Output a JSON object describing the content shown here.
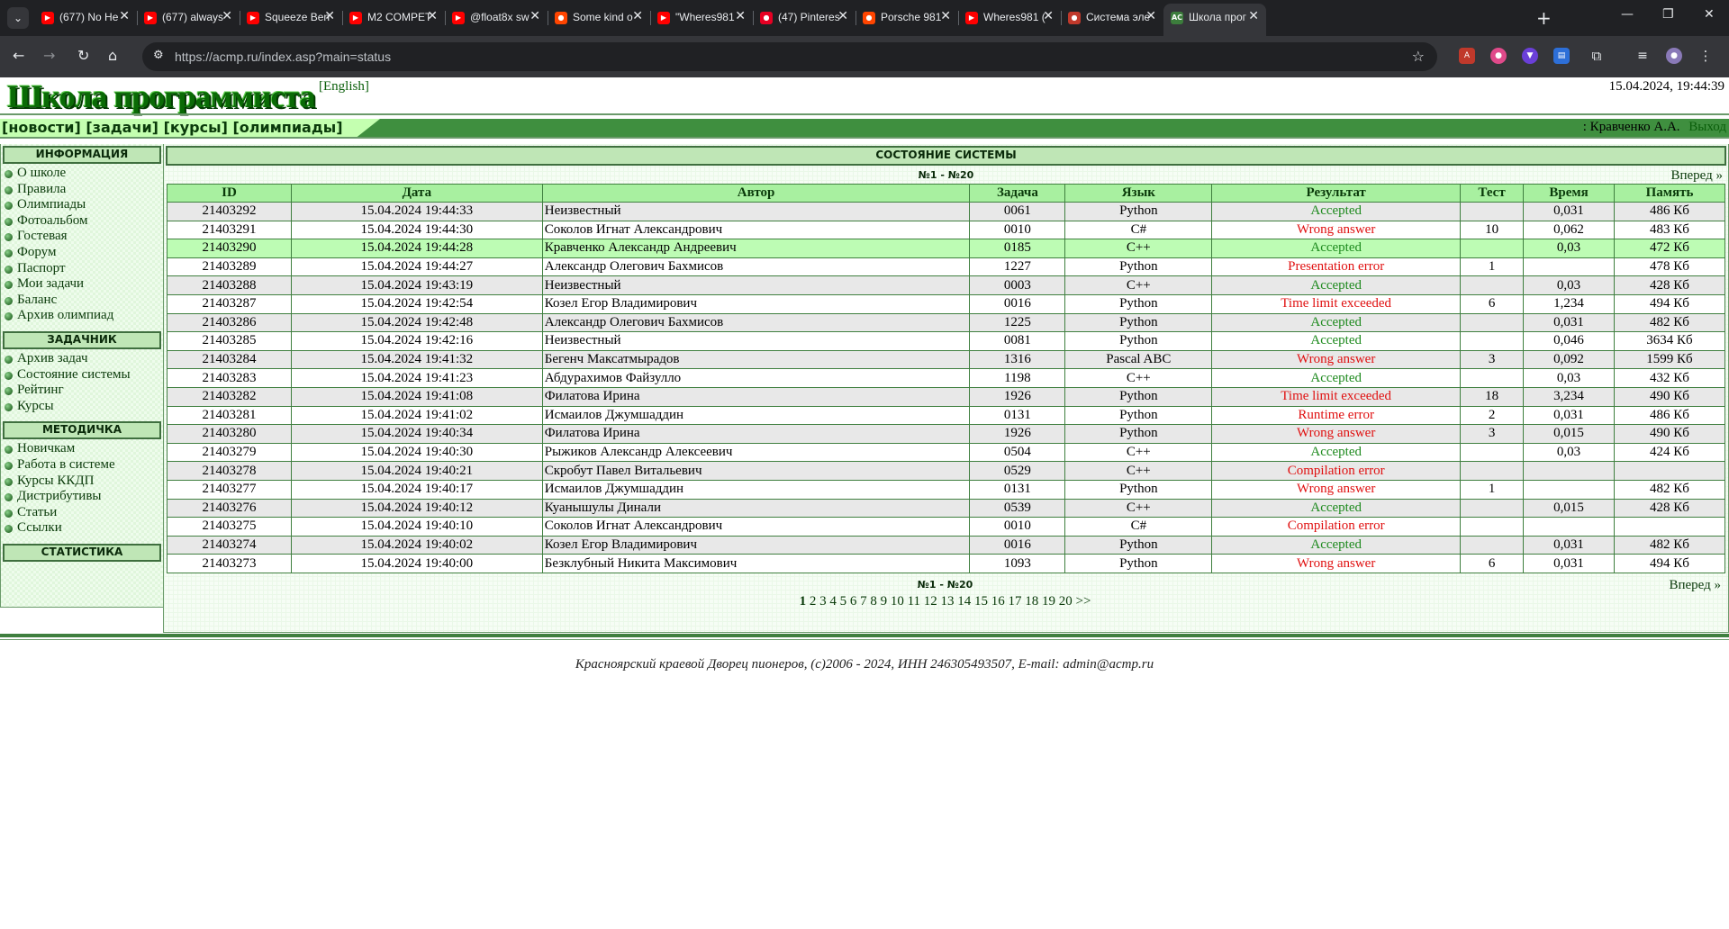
{
  "browser": {
    "tabs": [
      {
        "title": "(677) No He",
        "icon": "youtube-icon",
        "color": "#ff0000"
      },
      {
        "title": "(677) always",
        "icon": "youtube-icon",
        "color": "#ff0000"
      },
      {
        "title": "Squeeze Ben",
        "icon": "youtube-icon",
        "color": "#ff0000"
      },
      {
        "title": "M2 COMPETI",
        "icon": "youtube-icon",
        "color": "#ff0000"
      },
      {
        "title": "@float8x sw",
        "icon": "youtube-icon",
        "color": "#ff0000"
      },
      {
        "title": "Some kind o",
        "icon": "reddit-icon",
        "color": "#ff4500"
      },
      {
        "title": "\"Wheres981",
        "icon": "youtube-icon",
        "color": "#ff0000"
      },
      {
        "title": "(47) Pinteres",
        "icon": "pinterest-icon",
        "color": "#e60023"
      },
      {
        "title": "Porsche 981",
        "icon": "reddit-icon",
        "color": "#ff4500"
      },
      {
        "title": "Wheres981 (",
        "icon": "youtube-icon",
        "color": "#ff0000"
      },
      {
        "title": "Система эле",
        "icon": "im-icon",
        "color": "#c0392b"
      },
      {
        "title": "Школа прог",
        "icon": "acmp-icon",
        "color": "#3c7d3c",
        "active": true
      }
    ],
    "url": "https://acmp.ru/index.asp?main=status"
  },
  "site": {
    "logo": "Школа программиста",
    "lang_link": "[English]",
    "datetime": "15.04.2024, 19:44:39",
    "nav": [
      "[новости]",
      "[задачи]",
      "[курсы]",
      "[олимпиады]"
    ],
    "user": ": Кравченко А.А.",
    "logout": "Выход"
  },
  "sidebar": {
    "sections": [
      {
        "title": "ИНФОРМАЦИЯ",
        "items": [
          "О школе",
          "Правила",
          "Олимпиады",
          "Фотоальбом",
          "Гостевая",
          "Форум",
          "Паспорт",
          "Мои задачи",
          "Баланс",
          "Архив олимпиад"
        ]
      },
      {
        "title": "ЗАДАЧНИК",
        "items": [
          "Архив задач",
          "Состояние системы",
          "Рейтинг",
          "Курсы"
        ]
      },
      {
        "title": "МЕТОДИЧКА",
        "items": [
          "Новичкам",
          "Работа в системе",
          "Курсы ККДП",
          "Дистрибутивы",
          "Статьи",
          "Ссылки"
        ]
      },
      {
        "title": "СТАТИСТИКА",
        "items": []
      }
    ]
  },
  "main": {
    "title": "СОСТОЯНИЕ СИСТЕМЫ",
    "range": "№1 - №20",
    "next": "Вперед »",
    "columns": [
      "ID",
      "Дата",
      "Автор",
      "Задача",
      "Язык",
      "Результат",
      "Тест",
      "Время",
      "Память"
    ],
    "rows": [
      {
        "id": "21403292",
        "date": "15.04.2024 19:44:33",
        "author": "Неизвестный",
        "task": "0061",
        "lang": "Python",
        "result": "Accepted",
        "ok": true,
        "test": "",
        "time": "0,031",
        "mem": "486 Кб"
      },
      {
        "id": "21403291",
        "date": "15.04.2024 19:44:30",
        "author": "Соколов Игнат Александрович",
        "task": "0010",
        "lang": "C#",
        "result": "Wrong answer",
        "ok": false,
        "test": "10",
        "time": "0,062",
        "mem": "483 Кб"
      },
      {
        "id": "21403290",
        "date": "15.04.2024 19:44:28",
        "author": "Кравченко Александр Андреевич",
        "task": "0185",
        "lang": "C++",
        "result": "Accepted",
        "ok": true,
        "test": "",
        "time": "0,03",
        "mem": "472 Кб",
        "mine": true
      },
      {
        "id": "21403289",
        "date": "15.04.2024 19:44:27",
        "author": "Александр Олегович Бахмисов",
        "task": "1227",
        "lang": "Python",
        "result": "Presentation error",
        "ok": false,
        "test": "1",
        "time": "",
        "mem": "478 Кб"
      },
      {
        "id": "21403288",
        "date": "15.04.2024 19:43:19",
        "author": "Неизвестный",
        "task": "0003",
        "lang": "C++",
        "result": "Accepted",
        "ok": true,
        "test": "",
        "time": "0,03",
        "mem": "428 Кб"
      },
      {
        "id": "21403287",
        "date": "15.04.2024 19:42:54",
        "author": "Козел Егор Владимирович",
        "task": "0016",
        "lang": "Python",
        "result": "Time limit exceeded",
        "ok": false,
        "test": "6",
        "time": "1,234",
        "mem": "494 Кб"
      },
      {
        "id": "21403286",
        "date": "15.04.2024 19:42:48",
        "author": "Александр Олегович Бахмисов",
        "task": "1225",
        "lang": "Python",
        "result": "Accepted",
        "ok": true,
        "test": "",
        "time": "0,031",
        "mem": "482 Кб"
      },
      {
        "id": "21403285",
        "date": "15.04.2024 19:42:16",
        "author": "Неизвестный",
        "task": "0081",
        "lang": "Python",
        "result": "Accepted",
        "ok": true,
        "test": "",
        "time": "0,046",
        "mem": "3634 Кб"
      },
      {
        "id": "21403284",
        "date": "15.04.2024 19:41:32",
        "author": "Бегенч Максатмырадов",
        "task": "1316",
        "lang": "Pascal ABC",
        "result": "Wrong answer",
        "ok": false,
        "test": "3",
        "time": "0,092",
        "mem": "1599 Кб"
      },
      {
        "id": "21403283",
        "date": "15.04.2024 19:41:23",
        "author": "Абдурахимов Файзулло",
        "task": "1198",
        "lang": "C++",
        "result": "Accepted",
        "ok": true,
        "test": "",
        "time": "0,03",
        "mem": "432 Кб"
      },
      {
        "id": "21403282",
        "date": "15.04.2024 19:41:08",
        "author": "Филатова Ирина",
        "task": "1926",
        "lang": "Python",
        "result": "Time limit exceeded",
        "ok": false,
        "test": "18",
        "time": "3,234",
        "mem": "490 Кб"
      },
      {
        "id": "21403281",
        "date": "15.04.2024 19:41:02",
        "author": "Исмаилов Джумшаддин",
        "task": "0131",
        "lang": "Python",
        "result": "Runtime error",
        "ok": false,
        "test": "2",
        "time": "0,031",
        "mem": "486 Кб"
      },
      {
        "id": "21403280",
        "date": "15.04.2024 19:40:34",
        "author": "Филатова Ирина",
        "task": "1926",
        "lang": "Python",
        "result": "Wrong answer",
        "ok": false,
        "test": "3",
        "time": "0,015",
        "mem": "490 Кб"
      },
      {
        "id": "21403279",
        "date": "15.04.2024 19:40:30",
        "author": "Рыжиков Александр Алексеевич",
        "task": "0504",
        "lang": "C++",
        "result": "Accepted",
        "ok": true,
        "test": "",
        "time": "0,03",
        "mem": "424 Кб"
      },
      {
        "id": "21403278",
        "date": "15.04.2024 19:40:21",
        "author": "Скробут Павел Витальевич",
        "task": "0529",
        "lang": "C++",
        "result": "Compilation error",
        "ok": false,
        "test": "",
        "time": "",
        "mem": ""
      },
      {
        "id": "21403277",
        "date": "15.04.2024 19:40:17",
        "author": "Исмаилов Джумшаддин",
        "task": "0131",
        "lang": "Python",
        "result": "Wrong answer",
        "ok": false,
        "test": "1",
        "time": "",
        "mem": "482 Кб"
      },
      {
        "id": "21403276",
        "date": "15.04.2024 19:40:12",
        "author": "Куанышулы Динали",
        "task": "0539",
        "lang": "C++",
        "result": "Accepted",
        "ok": true,
        "test": "",
        "time": "0,015",
        "mem": "428 Кб"
      },
      {
        "id": "21403275",
        "date": "15.04.2024 19:40:10",
        "author": "Соколов Игнат Александрович",
        "task": "0010",
        "lang": "C#",
        "result": "Compilation error",
        "ok": false,
        "test": "",
        "time": "",
        "mem": ""
      },
      {
        "id": "21403274",
        "date": "15.04.2024 19:40:02",
        "author": "Козел Егор Владимирович",
        "task": "0016",
        "lang": "Python",
        "result": "Accepted",
        "ok": true,
        "test": "",
        "time": "0,031",
        "mem": "482 Кб"
      },
      {
        "id": "21403273",
        "date": "15.04.2024 19:40:00",
        "author": "Безклубный Никита Максимович",
        "task": "1093",
        "lang": "Python",
        "result": "Wrong answer",
        "ok": false,
        "test": "6",
        "time": "0,031",
        "mem": "494 Кб"
      }
    ],
    "pages": [
      "1",
      "2",
      "3",
      "4",
      "5",
      "6",
      "7",
      "8",
      "9",
      "10",
      "11",
      "12",
      "13",
      "14",
      "15",
      "16",
      "17",
      "18",
      "19",
      "20",
      ">>"
    ],
    "current_page": "1"
  },
  "footer": "Красноярский краевой Дворец пионеров, (c)2006 - 2024, ИНН 246305493507, E-mail: admin@acmp.ru"
}
